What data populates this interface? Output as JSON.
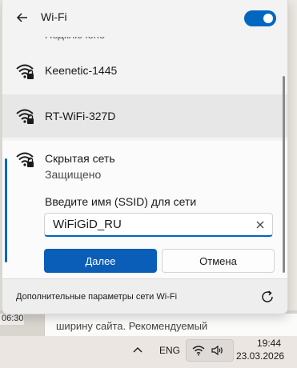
{
  "background": {
    "doc_text": "ширину сайта. Рекомендуемый",
    "left_time": "06:30"
  },
  "flyout": {
    "title": "Wi-Fi",
    "wifi_enabled": true,
    "connected_partial": "Подключено",
    "networks": [
      {
        "name": "Keenetic-1445",
        "secured": true
      },
      {
        "name": "RT-WiFi-327D",
        "secured": true
      }
    ],
    "hidden_network": {
      "name": "Скрытая сеть",
      "status": "Защищено",
      "ssid_label": "Введите имя (SSID) для сети",
      "ssid_value": "WiFiGiD_RU",
      "next_label": "Далее",
      "cancel_label": "Отмена"
    },
    "footer_link": "Дополнительные параметры сети Wi-Fi"
  },
  "taskbar": {
    "language": "ENG",
    "time": "19:44",
    "date": "23.03.2026"
  },
  "colors": {
    "accent": "#0067c0",
    "primary_button": "#0a5eb8"
  }
}
